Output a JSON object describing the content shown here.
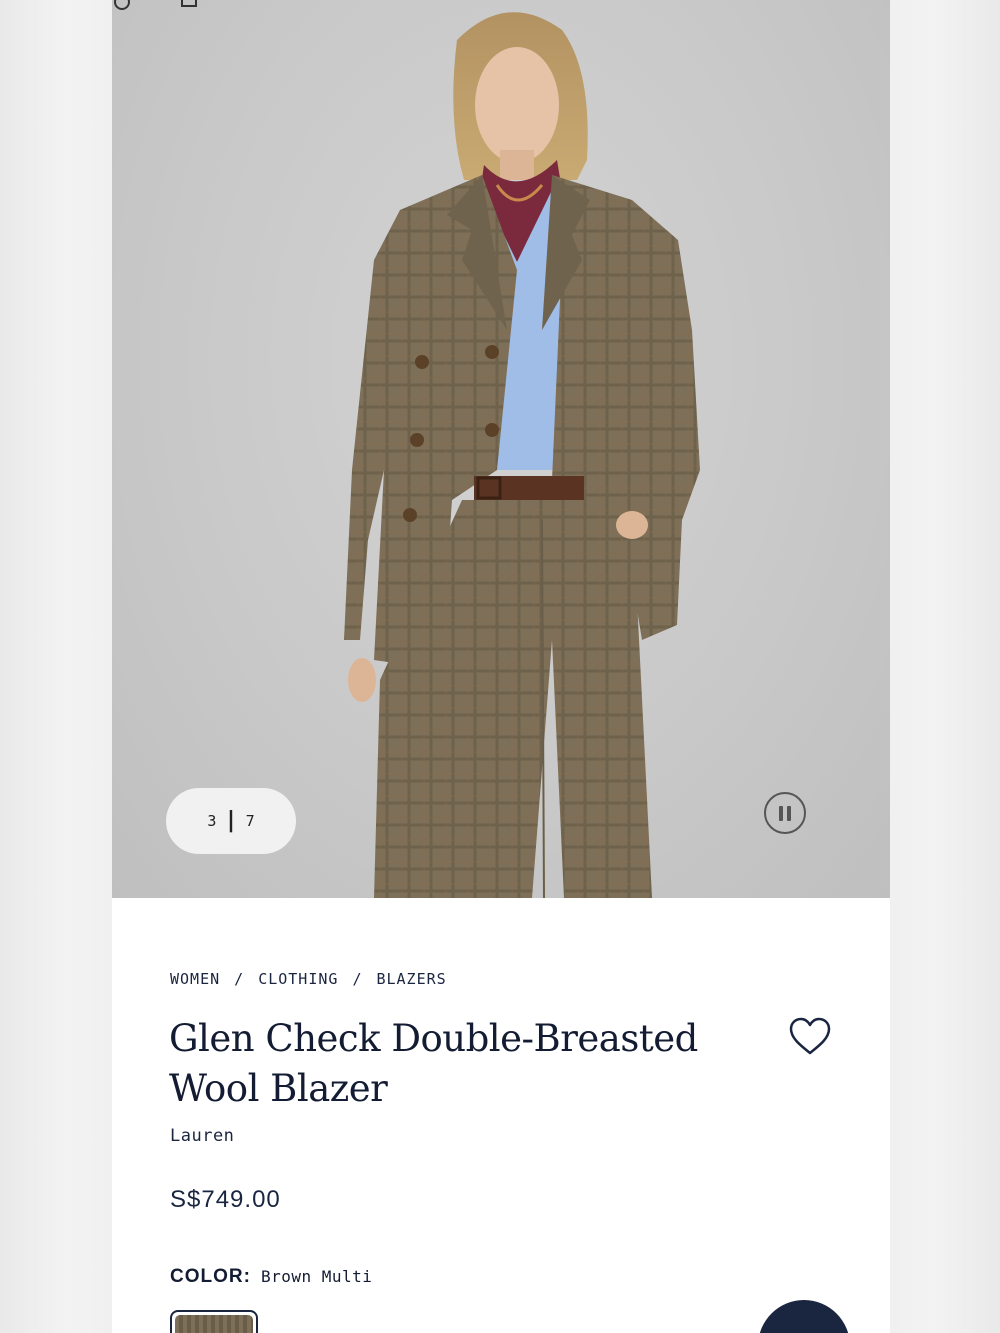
{
  "gallery": {
    "current": "3",
    "total": "7",
    "image_alt": ""
  },
  "breadcrumb": [
    "WOMEN",
    "CLOTHING",
    "BLAZERS"
  ],
  "product": {
    "title_line1": "Glen Check Double-Breasted",
    "title_line2": "Wool Blazer",
    "brand": "Lauren",
    "price": "S$749.00",
    "color_label": "COLOR:",
    "color_value": "Brown Multi"
  },
  "icons": {
    "pause": "pause-icon",
    "wishlist": "heart-icon"
  },
  "colors": {
    "navy": "#1a2540",
    "fabric": "#7a6c55"
  }
}
